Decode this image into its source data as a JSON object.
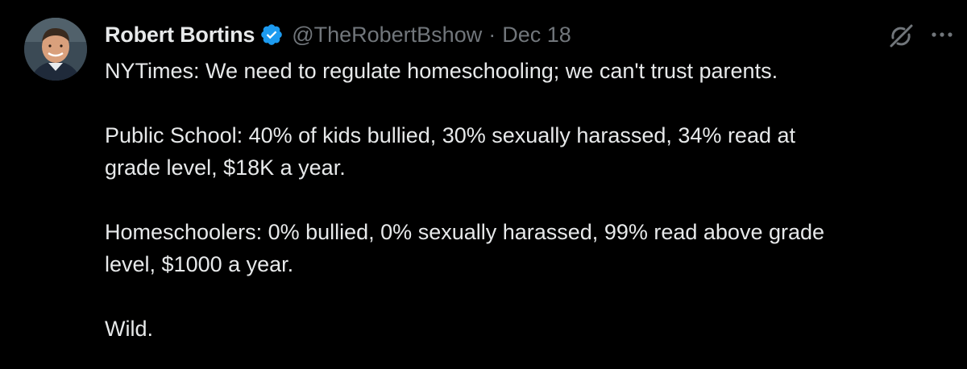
{
  "tweet": {
    "author": {
      "display_name": "Robert Bortins",
      "handle": "@TheRobertBshow",
      "verified": true,
      "verified_icon": "verified-badge-icon",
      "avatar": "avatar"
    },
    "separator": "·",
    "date": "Dec 18",
    "actions": {
      "grok_icon": "grok-icon",
      "more_icon": "more-icon"
    },
    "text": {
      "p1": "NYTimes: We need to regulate homeschooling; we can't trust parents.",
      "p2_line1": "Public School: 40% of kids bullied, 30% sexually harassed, 34% read at",
      "p2_line2": "grade level, $18K a year.",
      "p3_line1": "Homeschoolers: 0% bullied, 0% sexually harassed, 99% read above grade",
      "p3_line2": "level, $1000 a year.",
      "p4": "Wild."
    }
  },
  "colors": {
    "background": "#000000",
    "primary_text": "#e7e9ea",
    "secondary_text": "#71767b",
    "verified_blue": "#1d9bf0"
  }
}
